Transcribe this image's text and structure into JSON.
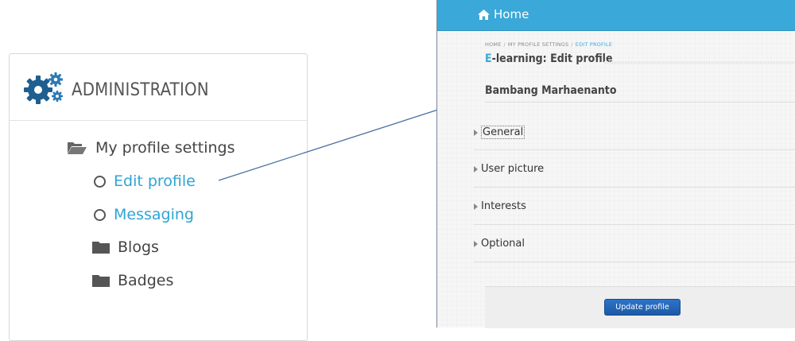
{
  "admin": {
    "title": "ADMINISTRATION",
    "items": [
      {
        "label": "My profile settings",
        "icon": "folder-open-icon"
      },
      {
        "label": "Edit profile",
        "icon": "circle-icon"
      },
      {
        "label": "Messaging",
        "icon": "circle-icon"
      },
      {
        "label": "Blogs",
        "icon": "folder-icon"
      },
      {
        "label": "Badges",
        "icon": "folder-icon"
      }
    ]
  },
  "navbar": {
    "home_label": "Home",
    "color": "#3aa8d8"
  },
  "breadcrumb": {
    "items": [
      "HOME",
      "MY PROFILE SETTINGS",
      "EDIT PROFILE"
    ],
    "separator": "/"
  },
  "page": {
    "title_accent": "E",
    "title_rest": "-learning: Edit profile",
    "user_name": "Bambang Marhaenanto"
  },
  "sections": [
    {
      "label": "General"
    },
    {
      "label": "User picture"
    },
    {
      "label": "Interests"
    },
    {
      "label": "Optional"
    }
  ],
  "form": {
    "submit_label": "Update profile"
  },
  "colors": {
    "link": "#2fa4d4",
    "button": "#2366bb"
  }
}
